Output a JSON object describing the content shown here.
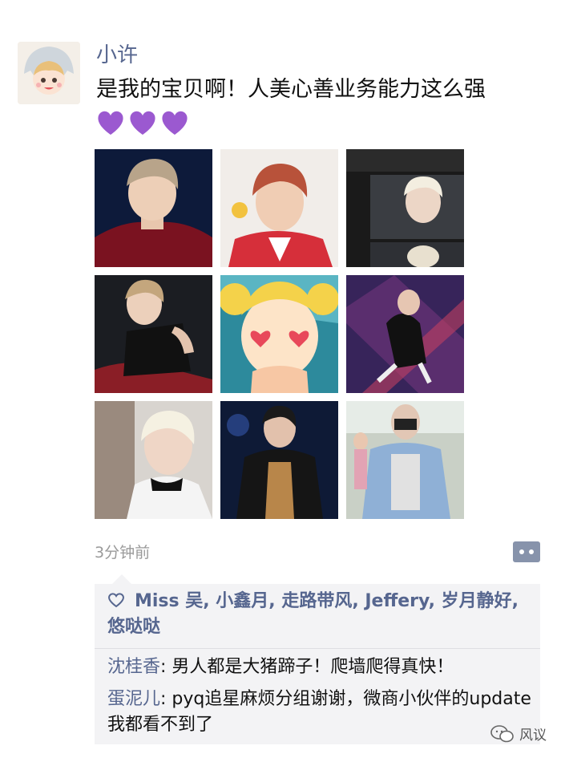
{
  "post": {
    "username": "小许",
    "text": "是我的宝贝啊！人美心善业务能力这么强",
    "hearts": [
      "purple-heart",
      "purple-heart",
      "purple-heart"
    ],
    "heart_color": "#9b59d0",
    "timestamp": "3分钟前",
    "photo_count": 9
  },
  "likes": {
    "icon": "heart-outline-icon",
    "names": "Miss 吴, 小鑫月, 走路带风, Jeffery, 岁月静好,悠哒哒"
  },
  "comments": [
    {
      "author": "沈桂香",
      "separator": ": ",
      "text": "男人都是大猪蹄子！爬墙爬得真快！"
    },
    {
      "author": "蛋泥儿",
      "separator": ": ",
      "text": "pyq追星麻烦分组谢谢，微商小伙伴的update我都看不到了"
    }
  ],
  "watermark": {
    "text": "风议",
    "icon": "wechat-icon"
  },
  "colors": {
    "link": "#56668f",
    "muted": "#9a9a9a",
    "comment_bg": "#f3f3f5",
    "comment_button": "#8793ab"
  }
}
